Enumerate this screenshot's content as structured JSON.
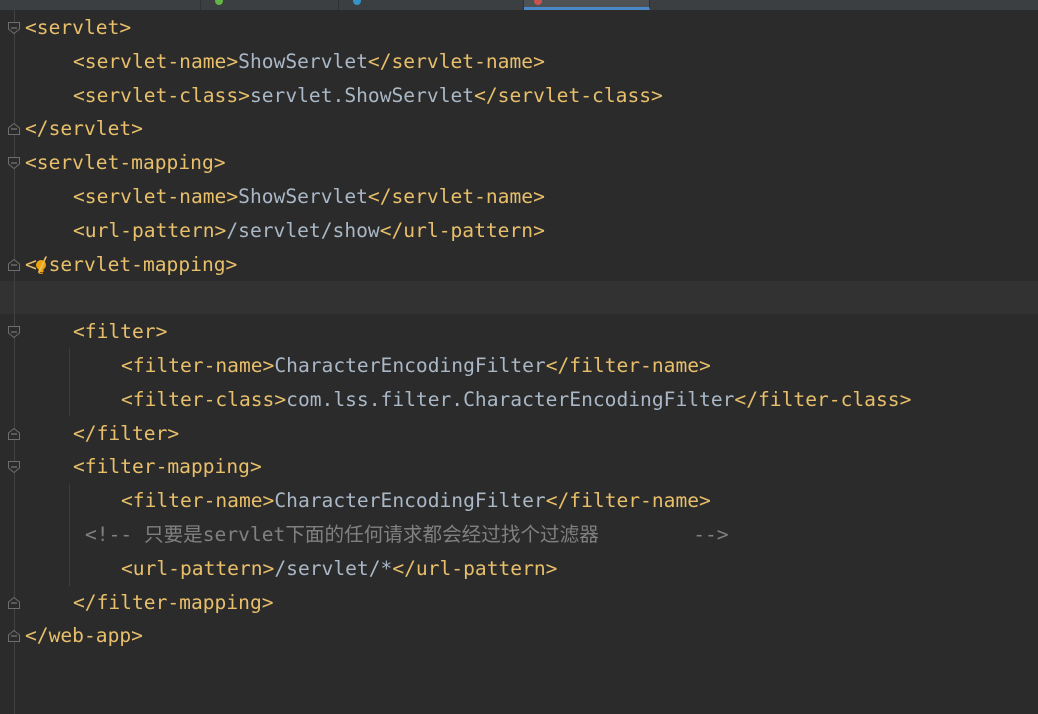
{
  "editor": {
    "lines": [
      {
        "indent": 0,
        "segments": [
          {
            "t": "tag",
            "v": "<servlet>"
          }
        ]
      },
      {
        "indent": 4,
        "segments": [
          {
            "t": "tag",
            "v": "<servlet-name>"
          },
          {
            "t": "txt",
            "v": "ShowServlet"
          },
          {
            "t": "tag",
            "v": "</servlet-name>"
          }
        ]
      },
      {
        "indent": 4,
        "segments": [
          {
            "t": "tag",
            "v": "<servlet-class>"
          },
          {
            "t": "txt",
            "v": "servlet.ShowServlet"
          },
          {
            "t": "tag",
            "v": "</servlet-class>"
          }
        ]
      },
      {
        "indent": 0,
        "segments": [
          {
            "t": "tag",
            "v": "</servlet>"
          }
        ]
      },
      {
        "indent": 0,
        "segments": [
          {
            "t": "tag",
            "v": "<servlet-mapping>"
          }
        ]
      },
      {
        "indent": 4,
        "segments": [
          {
            "t": "tag",
            "v": "<servlet-name>"
          },
          {
            "t": "txt",
            "v": "ShowServlet"
          },
          {
            "t": "tag",
            "v": "</servlet-name>"
          }
        ]
      },
      {
        "indent": 4,
        "segments": [
          {
            "t": "tag",
            "v": "<url-pattern>"
          },
          {
            "t": "txt",
            "v": "/servlet/show"
          },
          {
            "t": "tag",
            "v": "</url-pattern>"
          }
        ]
      },
      {
        "indent": 0,
        "segments": [
          {
            "t": "tag",
            "v": "</servlet-mapping>"
          }
        ]
      },
      {
        "indent": 0,
        "segments": []
      },
      {
        "indent": 4,
        "segments": [
          {
            "t": "tag",
            "v": "<filter>"
          }
        ]
      },
      {
        "indent": 8,
        "segments": [
          {
            "t": "tag",
            "v": "<filter-name>"
          },
          {
            "t": "txt",
            "v": "CharacterEncodingFilter"
          },
          {
            "t": "tag",
            "v": "</filter-name>"
          }
        ]
      },
      {
        "indent": 8,
        "segments": [
          {
            "t": "tag",
            "v": "<filter-class>"
          },
          {
            "t": "txt",
            "v": "com.lss.filter.CharacterEncodingFilter"
          },
          {
            "t": "tag",
            "v": "</filter-class>"
          }
        ]
      },
      {
        "indent": 4,
        "segments": [
          {
            "t": "tag",
            "v": "</filter>"
          }
        ]
      },
      {
        "indent": 4,
        "segments": [
          {
            "t": "tag",
            "v": "<filter-mapping>"
          }
        ]
      },
      {
        "indent": 8,
        "segments": [
          {
            "t": "tag",
            "v": "<filter-name>"
          },
          {
            "t": "txt",
            "v": "CharacterEncodingFilter"
          },
          {
            "t": "tag",
            "v": "</filter-name>"
          }
        ]
      },
      {
        "indent": 5,
        "segments": [
          {
            "t": "cmt",
            "v": "<!-- 只要是servlet下面的任何请求都会经过找个过滤器        -->"
          }
        ]
      },
      {
        "indent": 8,
        "segments": [
          {
            "t": "tag",
            "v": "<url-pattern>"
          },
          {
            "t": "txt",
            "v": "/servlet/*"
          },
          {
            "t": "tag",
            "v": "</url-pattern>"
          }
        ]
      },
      {
        "indent": 4,
        "segments": [
          {
            "t": "tag",
            "v": "</filter-mapping>"
          }
        ]
      },
      {
        "indent": 0,
        "segments": [
          {
            "t": "tag",
            "v": "</web-app>"
          }
        ]
      }
    ]
  },
  "colors": {
    "background": "#2b2b2b",
    "tag": "#e8bf6a",
    "text": "#a9b7c6",
    "comment": "#808080",
    "current_line": "#323232"
  },
  "icons": {
    "fold_markers": "fold-marker-icon",
    "intention": "lightbulb-icon"
  }
}
